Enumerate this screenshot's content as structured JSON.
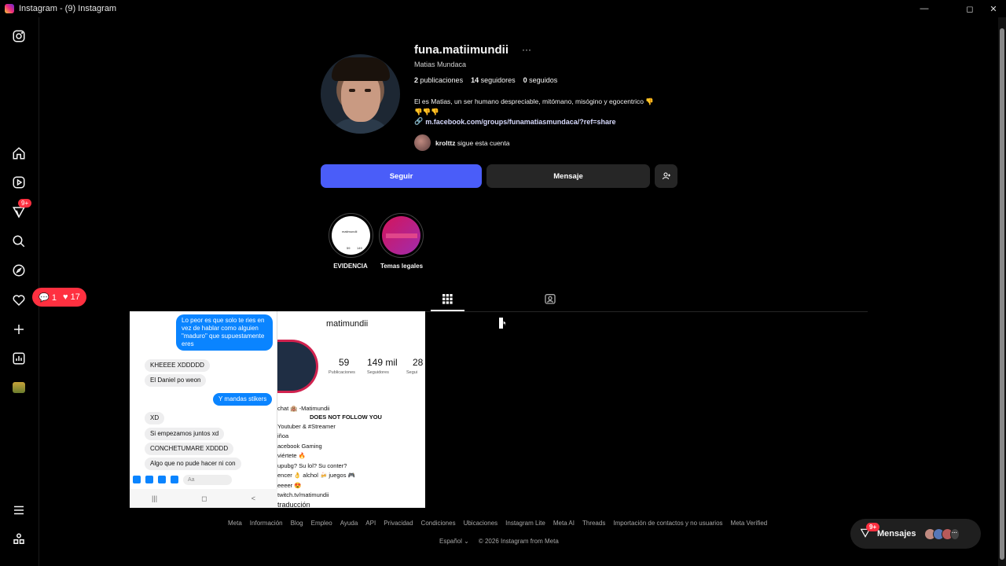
{
  "window": {
    "title": "Instagram - (9) Instagram",
    "minimize": "—",
    "maximize": "◻",
    "close": "✕"
  },
  "sidebar": {
    "notifications_badge": "9+",
    "activity": {
      "comments": "1",
      "likes": "17"
    }
  },
  "profile": {
    "username": "funa.matiimundii",
    "more": "···",
    "full_name": "Matias Mundaca",
    "stats": {
      "posts_count": "2",
      "posts_label": "publicaciones",
      "followers_count": "14",
      "followers_label": "seguidores",
      "following_count": "0",
      "following_label": "seguidos"
    },
    "bio_line1": "El es Matias, un ser humano despreciable, mitómano, misógino y egocentrico 👎",
    "bio_line2": "👎👎👎",
    "link": "m.facebook.com/groups/funamatiasmundaca/?ref=share",
    "followed_by_user": "krolttz",
    "followed_by_text": " sigue esta cuenta",
    "follow_button": "Seguir",
    "message_button": "Mensaje"
  },
  "highlights": [
    {
      "label": "EVIDENCIA",
      "inner_name": "matimundii",
      "inner_n1": "59",
      "inner_n2": "149"
    },
    {
      "label": "Temas legales"
    }
  ],
  "post": {
    "chat_bubbles": [
      "Lo peor es que solo te ries en vez de hablar como alguien \"maduro\" que supuestamente eres",
      "KHEEEE XDDDDD",
      "El Daniel po weon",
      "Y mandas stikers",
      "XD",
      "Si empezamos juntos xd",
      "CONCHETUMARE XDDDD",
      "Algo que no pude hacer ni con"
    ],
    "chat_input_placeholder": "Aa",
    "nav": [
      "|||",
      "◻",
      "<"
    ],
    "ig_username": "matimundii",
    "ig_stats": [
      {
        "value": "59",
        "label": "Publicaciones"
      },
      {
        "value": "149 mil",
        "label": "Seguidores"
      },
      {
        "value": "28",
        "label": "Segui"
      }
    ],
    "ig_lines": [
      "chat 🏨 -Matimundii",
      "DOES NOT FOLLOW YOU",
      "Youtuber & #Streamer",
      "iñoa",
      "acebook Gaming",
      "viértete 🔥",
      "upubg? Su lol? Su conter?",
      "encer 👌 alchol 🍻 juegos 🎮",
      "eeeer 😍",
      "twitch.tv/matimundii",
      "traducción"
    ]
  },
  "footer": {
    "links": [
      "Meta",
      "Información",
      "Blog",
      "Empleo",
      "Ayuda",
      "API",
      "Privacidad",
      "Condiciones",
      "Ubicaciones",
      "Instagram Lite",
      "Meta AI",
      "Threads",
      "Importación de contactos y no usuarios",
      "Meta Verified"
    ],
    "language": "Español",
    "language_chevron": "⌄",
    "copyright": "© 2026 Instagram from Meta"
  },
  "messages_pill": {
    "label": "Mensajes",
    "badge": "9+",
    "more": "···"
  },
  "colors": {
    "accent": "#4a5df9",
    "badge": "#ff3040",
    "background": "#000000"
  }
}
